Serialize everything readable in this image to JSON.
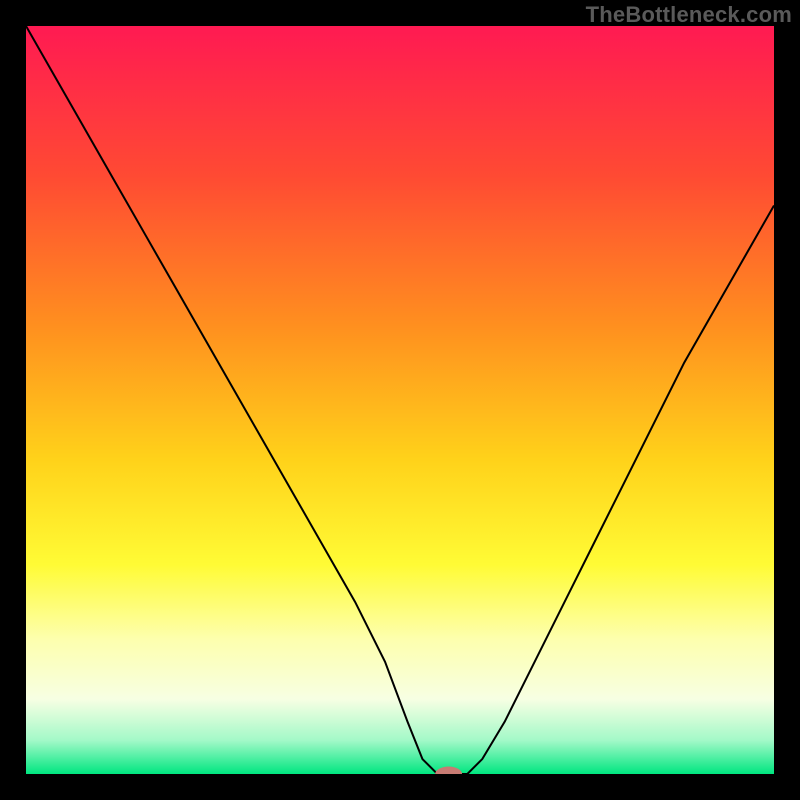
{
  "watermark": "TheBottleneck.com",
  "chart_data": {
    "type": "line",
    "title": "",
    "xlabel": "",
    "ylabel": "",
    "xlim": [
      0,
      100
    ],
    "ylim": [
      0,
      100
    ],
    "background": {
      "mode": "vertical-gradient",
      "stops": [
        {
          "t": 0.0,
          "color": "#ff1a52"
        },
        {
          "t": 0.2,
          "color": "#ff4a33"
        },
        {
          "t": 0.4,
          "color": "#ff8f1f"
        },
        {
          "t": 0.58,
          "color": "#ffd21a"
        },
        {
          "t": 0.72,
          "color": "#fffb35"
        },
        {
          "t": 0.82,
          "color": "#fdffae"
        },
        {
          "t": 0.9,
          "color": "#f7ffe3"
        },
        {
          "t": 0.955,
          "color": "#a3f9c8"
        },
        {
          "t": 1.0,
          "color": "#00e680"
        }
      ]
    },
    "series": [
      {
        "name": "bottleneck-curve",
        "stroke": "#000000",
        "stroke_width": 2,
        "x": [
          0,
          4,
          8,
          12,
          16,
          20,
          24,
          28,
          32,
          36,
          40,
          44,
          48,
          51,
          53,
          55,
          57,
          59,
          61,
          64,
          68,
          72,
          76,
          80,
          84,
          88,
          92,
          96,
          100
        ],
        "values": [
          100,
          93,
          86,
          79,
          72,
          65,
          58,
          51,
          44,
          37,
          30,
          23,
          15,
          7,
          2,
          0,
          0,
          0,
          2,
          7,
          15,
          23,
          31,
          39,
          47,
          55,
          62,
          69,
          76
        ]
      }
    ],
    "marker": {
      "name": "optimal-point",
      "x": 56.5,
      "y": 0,
      "rx": 1.8,
      "ry": 1.0,
      "fill": "#c77b73"
    }
  }
}
